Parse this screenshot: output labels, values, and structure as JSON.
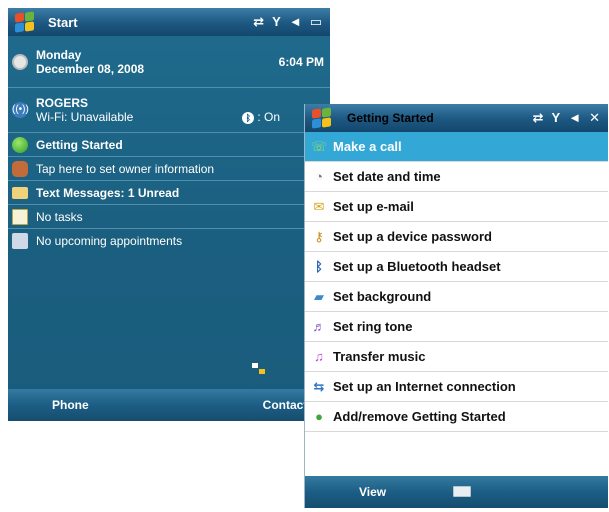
{
  "left_screen": {
    "title": "Start",
    "clock": {
      "day": "Monday",
      "date": "December 08, 2008",
      "time": "6:04 PM"
    },
    "carrier": {
      "name": "ROGERS",
      "wifi": "Wi-Fi: Unavailable",
      "bluetooth": ": On"
    },
    "items": {
      "getting_started": "Getting Started",
      "owner": "Tap here to set owner information",
      "messages": "Text Messages: 1 Unread",
      "tasks": "No tasks",
      "appointments": "No upcoming appointments"
    },
    "softkeys": {
      "left": "Phone",
      "right": "Contacts"
    }
  },
  "right_screen": {
    "title": "Getting Started",
    "menu": [
      {
        "label": "Make a call",
        "icon": "phone-call-icon",
        "selected": true
      },
      {
        "label": "Set date and time",
        "icon": "clock-icon"
      },
      {
        "label": "Set up e-mail",
        "icon": "email-icon"
      },
      {
        "label": "Set up a device password",
        "icon": "key-icon"
      },
      {
        "label": "Set up a Bluetooth headset",
        "icon": "bluetooth-icon"
      },
      {
        "label": "Set background",
        "icon": "background-icon"
      },
      {
        "label": "Set ring tone",
        "icon": "ringtone-icon"
      },
      {
        "label": "Transfer music",
        "icon": "music-note-icon"
      },
      {
        "label": "Set up an Internet connection",
        "icon": "network-icon"
      },
      {
        "label": "Add/remove Getting Started",
        "icon": "add-remove-icon"
      }
    ],
    "softkeys": {
      "left": "View"
    }
  },
  "colors": {
    "title_bar": "#1e5a84",
    "today_background": "#1b5f80",
    "selection": "#33a8d6"
  }
}
